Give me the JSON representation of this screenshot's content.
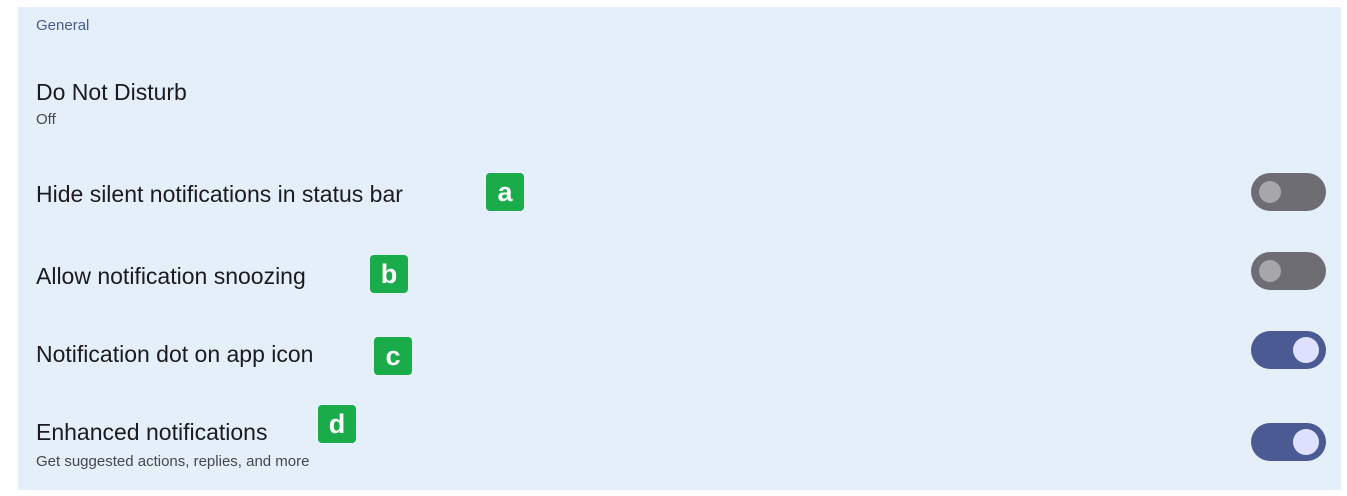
{
  "section": {
    "header": "General"
  },
  "settings": [
    {
      "title": "Do Not Disturb",
      "subtitle": "Off"
    },
    {
      "title": "Hide silent notifications in status bar",
      "badge": "a",
      "toggle": "off"
    },
    {
      "title": "Allow notification snoozing",
      "badge": "b",
      "toggle": "off"
    },
    {
      "title": "Notification dot on app icon",
      "badge": "c",
      "toggle": "on"
    },
    {
      "title": "Enhanced notifications",
      "subtitle": "Get suggested actions, replies, and more",
      "badge": "d",
      "toggle": "on"
    }
  ],
  "colors": {
    "panel_background": "#e5eff9",
    "toggle_on": "#4b5a93",
    "toggle_off": "#6e6d73",
    "badge": "#1aab4a"
  }
}
